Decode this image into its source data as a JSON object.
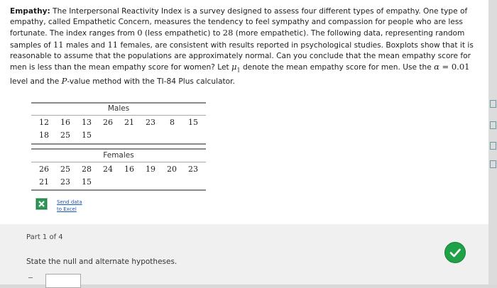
{
  "problem": {
    "title": "Empathy:",
    "p1": " The Interpersonal Reactivity Index is a survey designed to assess four different types of empathy. One type of empathy, called Empathetic Concern, measures the tendency to feel sympathy and compassion for people who are less fortunate. The index ranges from ",
    "v0": "0",
    "p2": " (less empathetic) to ",
    "v28": "28",
    "p3": " (more empathetic). The following data, representing random samples of ",
    "v11a": "11",
    "p4": " males and ",
    "v11b": "11",
    "p5": " females, are consistent with results reported in psychological studies. Boxplots show that it is reasonable to assume that the populations are approximately normal. Can you conclude that the mean empathy score for men is less than the mean empathy score for women? Let ",
    "mu1": "μ",
    "mu1_sub": "1",
    "p6": " denote the mean empathy score for men. Use the ",
    "alpha": "α",
    "eq": " = ",
    "alpha_val": "0.01",
    "p7": " level and the ",
    "pval": "P",
    "p8": "-value method with the TI-84 Plus calculator."
  },
  "males": {
    "header": "Males",
    "row1": [
      "12",
      "16",
      "13",
      "26",
      "21",
      "23",
      "8",
      "15"
    ],
    "row2": [
      "18",
      "25",
      "15"
    ]
  },
  "females": {
    "header": "Females",
    "row1": [
      "26",
      "25",
      "28",
      "24",
      "16",
      "19",
      "20",
      "23"
    ],
    "row2": [
      "21",
      "23",
      "15"
    ]
  },
  "send_data": {
    "line1": "Send data",
    "line2": "to Excel"
  },
  "part": {
    "label": "Part 1 of 4",
    "instruction": "State the null and alternate hypotheses."
  },
  "icons": {
    "excel": "excel-icon",
    "check": "check-icon",
    "accent_green": "#1fa148",
    "link_blue": "#1a55c0"
  }
}
